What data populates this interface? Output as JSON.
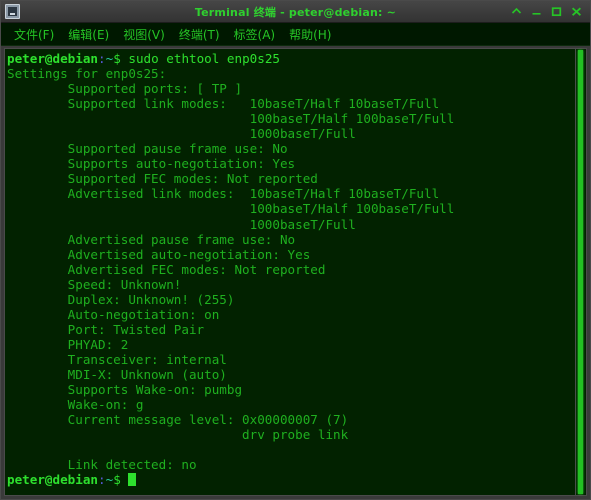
{
  "window": {
    "title": "Terminal 终端 - peter@debian: ~",
    "icon": "terminal-icon",
    "controls": {
      "shade_label": "^",
      "minimize_label": "_",
      "maximize_label": "□",
      "close_label": "✕"
    }
  },
  "menubar": {
    "items": [
      {
        "label": "文件(F)"
      },
      {
        "label": "编辑(E)"
      },
      {
        "label": "视图(V)"
      },
      {
        "label": "终端(T)"
      },
      {
        "label": "标签(A)"
      },
      {
        "label": "帮助(H)"
      }
    ]
  },
  "terminal": {
    "prompt": {
      "user_host": "peter@debian",
      "colon": ":",
      "path": "~",
      "sigil": "$"
    },
    "command": " sudo ethtool enp0s25",
    "output_lines": [
      "Settings for enp0s25:",
      "        Supported ports: [ TP ]",
      "        Supported link modes:   10baseT/Half 10baseT/Full",
      "                                100baseT/Half 100baseT/Full",
      "                                1000baseT/Full",
      "        Supported pause frame use: No",
      "        Supports auto-negotiation: Yes",
      "        Supported FEC modes: Not reported",
      "        Advertised link modes:  10baseT/Half 10baseT/Full",
      "                                100baseT/Half 100baseT/Full",
      "                                1000baseT/Full",
      "        Advertised pause frame use: No",
      "        Advertised auto-negotiation: Yes",
      "        Advertised FEC modes: Not reported",
      "        Speed: Unknown!",
      "        Duplex: Unknown! (255)",
      "        Auto-negotiation: on",
      "        Port: Twisted Pair",
      "        PHYAD: 2",
      "        Transceiver: internal",
      "        MDI-X: Unknown (auto)",
      "        Supports Wake-on: pumbg",
      "        Wake-on: g",
      "        Current message level: 0x00000007 (7)",
      "                               drv probe link",
      "",
      "        Link detected: no"
    ],
    "colors": {
      "background": "#022200",
      "foreground": "#1fb01f",
      "prompt_user": "#2ee02e",
      "prompt_colon": "#5757d6",
      "prompt_path": "#28c8a0",
      "cursor": "#2ee02e",
      "title": "#2fd12f"
    }
  }
}
